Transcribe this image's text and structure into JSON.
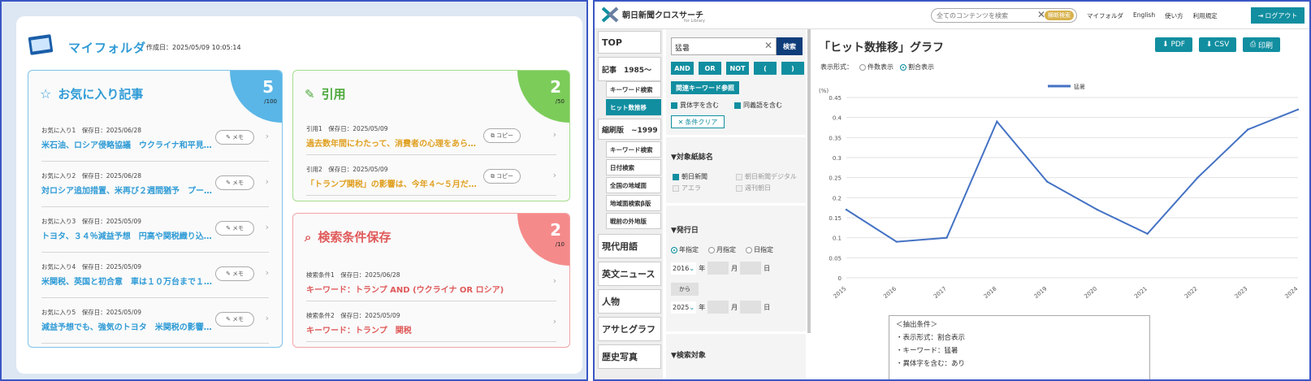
{
  "left": {
    "title": "マイフォルダ",
    "created": "作成日：2025/05/09 10:05:14",
    "favorites": {
      "title": "お気に入り記事",
      "count": "5",
      "max": "/100",
      "memo_label": "メモ",
      "items": [
        {
          "meta": "お気に入り1　保存日：2025/06/28",
          "title": "米石油、ロシア侵略協議　ウクライナ和平見…"
        },
        {
          "meta": "お気に入り2　保存日：2025/06/28",
          "title": "対ロシア追加措置、米再び２週間猶予　プー…"
        },
        {
          "meta": "お気に入り3　保存日：2025/05/09",
          "title": "トヨタ、３４％減益予想　円高や関税織り込…"
        },
        {
          "meta": "お気に入り4　保存日：2025/05/09",
          "title": "米関税、英国と初合意　車は１０万台まで１…"
        },
        {
          "meta": "お気に入り5　保存日：2025/05/09",
          "title": "減益予想でも、強気のトヨタ　米関税の影響…"
        }
      ]
    },
    "quotes": {
      "title": "引用",
      "count": "2",
      "max": "/50",
      "copy_label": "コピー",
      "items": [
        {
          "meta": "引用1　保存日：2025/05/09",
          "title": "過去数年間にわたって、消費者の心理をあら…"
        },
        {
          "meta": "引用2　保存日：2025/05/09",
          "title": "「トランプ関税」の影響は、今年４～５月だ…"
        }
      ]
    },
    "searches": {
      "title": "検索条件保存",
      "count": "2",
      "max": "/10",
      "items": [
        {
          "meta": "検索条件1　保存日：2025/06/28",
          "title": "キーワード：トランプ AND (ウクライナ OR ロシア)"
        },
        {
          "meta": "検索条件2　保存日：2025/05/09",
          "title": "キーワード：トランプ　関税"
        }
      ]
    }
  },
  "right": {
    "logo_text": "朝日新聞クロスサーチ",
    "logo_sub": "for Library",
    "search_placeholder": "全てのコンテンツを検索",
    "search_button": "横断検索",
    "top_links": [
      "マイフォルダ",
      "English",
      "使い方",
      "利用規定"
    ],
    "logout": "ログアウト",
    "nav": {
      "top": "TOP",
      "articles": "記事　1985～",
      "articles_subs": [
        "キーワード検索",
        "ヒット数推移"
      ],
      "shukusatsu": "縮刷版　~1999",
      "shuku_subs": [
        "キーワード検索",
        "日付検索",
        "全国の地域面",
        "地域面検索β版",
        "戦前の外地版"
      ],
      "others": [
        "現代用語",
        "英文ニュース",
        "人物",
        "アサヒグラフ",
        "歴史写真"
      ]
    },
    "form": {
      "keyword": "猛暑",
      "search_btn": "検索",
      "ops": [
        "AND",
        "OR",
        "NOT",
        "(",
        ")"
      ],
      "related_btn": "関連キーワード参照",
      "opt1": "異体字を含む",
      "opt2": "同義語を含む",
      "clear": "条件クリア",
      "papers_head": "▼対象紙誌名",
      "papers": [
        "朝日新聞",
        "朝日新聞デジタル",
        "アエラ",
        "週刊朝日"
      ],
      "date_head": "▼発行日",
      "date_modes": [
        "年指定",
        "月指定",
        "日指定"
      ],
      "from_year": "2016",
      "to_year": "2025",
      "y": "年",
      "m": "月",
      "d": "日",
      "kara": "から",
      "target_head": "▼検索対象"
    },
    "graph": {
      "title": "「ヒット数推移」グラフ",
      "pdf": "PDF",
      "csv": "CSV",
      "print": "印刷",
      "display_label": "表示形式：",
      "display_modes": [
        "件数表示",
        "割合表示"
      ],
      "conditions": [
        "＜抽出条件＞",
        "・表示形式：割合表示",
        "・キーワード：猛暑",
        "・異体字を含む：あり"
      ]
    },
    "chart_data": {
      "type": "line",
      "x": [
        "2015",
        "2016",
        "2017",
        "2018",
        "2019",
        "2020",
        "2021",
        "2022",
        "2023",
        "2024"
      ],
      "series": [
        {
          "name": "猛暑",
          "values": [
            0.17,
            0.09,
            0.1,
            0.39,
            0.24,
            0.17,
            0.11,
            0.25,
            0.37,
            0.42
          ]
        }
      ],
      "ylabel": "(%)",
      "ylim": [
        0,
        0.45
      ],
      "yticks": [
        "0",
        "0.05",
        "0.1",
        "0.15",
        "0.2",
        "0.25",
        "0.3",
        "0.35",
        "0.4",
        "0.45"
      ],
      "grid": true,
      "legend": "top-center",
      "color": "#4472c4"
    }
  }
}
